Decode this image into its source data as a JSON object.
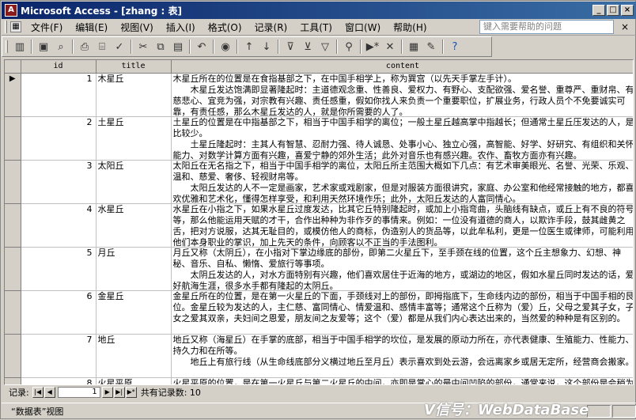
{
  "window": {
    "title": "Microsoft Access - [zhang : 表]",
    "app_icon": "access-icon"
  },
  "menu": {
    "items": [
      {
        "label": "文件(F)",
        "name": "menu-file"
      },
      {
        "label": "编辑(E)",
        "name": "menu-edit"
      },
      {
        "label": "视图(V)",
        "name": "menu-view"
      },
      {
        "label": "插入(I)",
        "name": "menu-insert"
      },
      {
        "label": "格式(O)",
        "name": "menu-format"
      },
      {
        "label": "记录(R)",
        "name": "menu-records"
      },
      {
        "label": "工具(T)",
        "name": "menu-tools"
      },
      {
        "label": "窗口(W)",
        "name": "menu-window"
      },
      {
        "label": "帮助(H)",
        "name": "menu-help"
      }
    ],
    "help_placeholder": "键入需要帮助的问题"
  },
  "toolbar": {
    "icons": [
      "view-icon",
      "save-icon",
      "search-icon",
      "print-icon",
      "print-preview-icon",
      "spelling-icon",
      "cut-icon",
      "copy-icon",
      "paste-icon",
      "undo-icon",
      "hyperlink-icon",
      "sort-ascending-icon",
      "sort-descending-icon",
      "filter-by-selection-icon",
      "filter-by-form-icon",
      "apply-filter-icon",
      "find-icon",
      "new-record-icon",
      "delete-record-icon",
      "database-window-icon",
      "new-object-icon",
      "help-icon"
    ]
  },
  "table": {
    "columns": [
      "id",
      "title",
      "content"
    ],
    "rows": [
      {
        "id": "1",
        "title": "木星丘",
        "p1": "木星丘所在的位置是在食指基部之下，在中国手相学上，称为巽宫（以先天手掌左手计）。",
        "p2": "木星丘发达饱满即显著隆起时：主道德观念重、性善良、爱权力、有野心、支配欲强、爱名誉、重尊严、重财帛、有慈悲心、宜竞为强，对宗教有兴趣、责任感重，假如你找人来负责一个重要职位，扩展业务，行政人员个不免要诚实可靠，有责任感，那么木星丘发达的人，就是你所需要的人了。"
      },
      {
        "id": "2",
        "title": "土星丘",
        "p1": "土星丘的位置是在中指基部之下，相当于中国手相学的离位；一般土星丘越高掌中指越长；但通常土星丘压发达的人，是比较少。",
        "p2": "土星丘隆起时：主其人有智慧、忍耐力强、待人诚恳、处事小心、独立心强，高智能、好学、好研究、有组织和关怀能力、对数学计算方面有兴趣，喜爱宁静的郊外生活；此外对音乐也有感兴趣。农作、畜牧方面亦有兴趣。"
      },
      {
        "id": "3",
        "title": "太阳丘",
        "p1": "太阳丘在无名指之下，相当于中国手相学的离位，太阳丘所主范围大概如下几点：有艺术审美眼光、名誉、光荣、乐观、温和、慈爱、奢侈、轻视财帛等。",
        "p2": "太阳丘发达的人不一定是画家，艺术家或戏剧家，但是对服装方面很讲究，家庭、办公室和他经常接触的地方，都喜欢优雅和艺术化，懂得怎样享受，和利用天然环境作乐；此外，太阳丘发达的人富同情心。"
      },
      {
        "id": "4",
        "title": "水星丘",
        "p1": "水星丘在小指之下，如果水星丘过度发达，比其它丘特别隆起时，或加上小指弯曲，头脑线有缺点，或丘上有不良的符号等，那么他能运用天赋的才干，合作出种种为非作歹的事情来。例如：一位没有道德的商人，以欺诈手段，鼓其雌黄之舌，把对方说服，达其无耻目的，或模仿他人的商标，伪造别人的货品等，以此牟私利，更是一位医生或律师，可能利用他们本身职业的掌识，加上先天的条件，向顾客以不正当的手法图利。"
      },
      {
        "id": "5",
        "title": "月丘",
        "p1": "月丘又称（太阴丘），在小指对下掌边缘底的部份，即第二火星丘下，至手颈在线的位置，这个丘主想象力、幻想、神秘、音乐、自私、懒惰、爱旅行等事项。",
        "p2": "太阴丘发达的人，对水方面特别有兴趣，他们喜欢居住于近海的地方，或湖边的地区，假如水星丘同时发达的话，爱好航海生涯，很多水手都有隆起的太阴丘。"
      },
      {
        "id": "6",
        "title": "金星丘",
        "p1": "金星丘所在的位置，是在第一火星丘的下面，手颈线对上的部份，即拇指底下，生命线内边的部份，相当于中国手相的艮位。金星丘较为发达的人，主仁慈、富同情心、情爱温和、感情丰富等；通常这个丘称为（爱）丘，父母之爱其子女，子女之爱其双亲，夫妇间之恩爱，朋友间之友爱等；这个（爱）都是从我们内心表达出来的，当然爱的种种是有区别的。"
      },
      {
        "id": "7",
        "title": "地丘",
        "p1": "地丘又称（海星丘）在手掌的底部，相当于中国手相学的坎位，是发展的原动力所在，亦代表健康、生殖能力、性能力、持久力和在所等。",
        "p2": "地丘上有旅行线（从生命线底部分义横过地丘至月丘）表示喜欢到处云游，会远离家乡或居无定所，经营商会搬家。"
      },
      {
        "id": "8",
        "title": "火星平原",
        "p1": "火星平原的位置，是在第一火星丘与第二火星丘的中间，亦即是掌心的最中间凹陷的部份，通常来说，这个部份是会稍为凹陷的。"
      }
    ]
  },
  "navigation": {
    "label": "记录:",
    "current": "1",
    "count_label": "共有记录数: 10"
  },
  "status": {
    "text": "“数据表”视图"
  },
  "watermark": {
    "text": "V信号：WebDataBase"
  }
}
